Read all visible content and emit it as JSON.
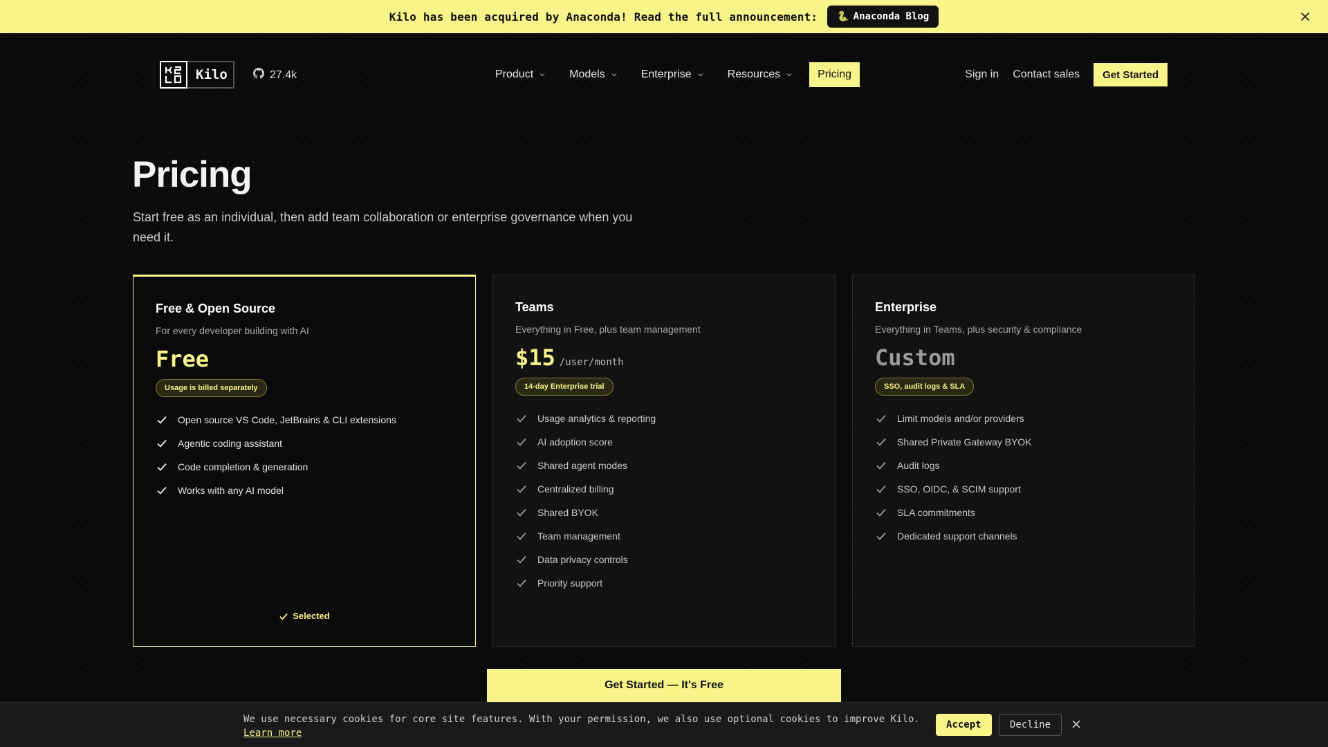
{
  "announcement": {
    "text": "Kilo has been acquired by Anaconda! Read the full announcement:",
    "link_label": "Anaconda Blog",
    "link_icon": "snake-icon"
  },
  "header": {
    "logo_text": "Kilo",
    "github_stars": "27.4k",
    "nav": [
      {
        "label": "Product"
      },
      {
        "label": "Models"
      },
      {
        "label": "Enterprise"
      },
      {
        "label": "Resources"
      }
    ],
    "pricing_label": "Pricing",
    "sign_in": "Sign in",
    "contact_sales": "Contact sales",
    "cta": "Get Started"
  },
  "hero": {
    "title": "Pricing",
    "subtitle": "Start free as an individual, then add team collaboration or enterprise governance when you need it."
  },
  "plans": [
    {
      "title": "Free & Open Source",
      "subtitle": "For every developer building with AI",
      "price": "Free",
      "unit": "",
      "badge": "Usage is billed separately",
      "features": [
        "Open source VS Code, JetBrains & CLI extensions",
        "Agentic coding assistant",
        "Code completion & generation",
        "Works with any AI model"
      ],
      "selected_label": "Selected"
    },
    {
      "title": "Teams",
      "subtitle": "Everything in Free, plus team management",
      "price": "$15",
      "unit": "/user/month",
      "badge": "14-day Enterprise trial",
      "features": [
        "Usage analytics & reporting",
        "AI adoption score",
        "Shared agent modes",
        "Centralized billing",
        "Shared BYOK",
        "Team management",
        "Data privacy controls",
        "Priority support"
      ]
    },
    {
      "title": "Enterprise",
      "subtitle": "Everything in Teams, plus security & compliance",
      "price": "Custom",
      "unit": "",
      "badge": "SSO, audit logs & SLA",
      "features": [
        "Limit models and/or providers",
        "Shared Private Gateway BYOK",
        "Audit logs",
        "SSO, OIDC, & SCIM support",
        "SLA commitments",
        "Dedicated support channels"
      ]
    }
  ],
  "main_cta": "Get Started — It's Free",
  "cookie": {
    "text": "We use necessary cookies for core site features. With your permission, we also use optional cookies to improve Kilo.",
    "learn_more": "Learn more",
    "accept": "Accept",
    "decline": "Decline"
  },
  "colors": {
    "accent": "#f7f48a",
    "background": "#0b0b0b",
    "card": "#121212"
  }
}
